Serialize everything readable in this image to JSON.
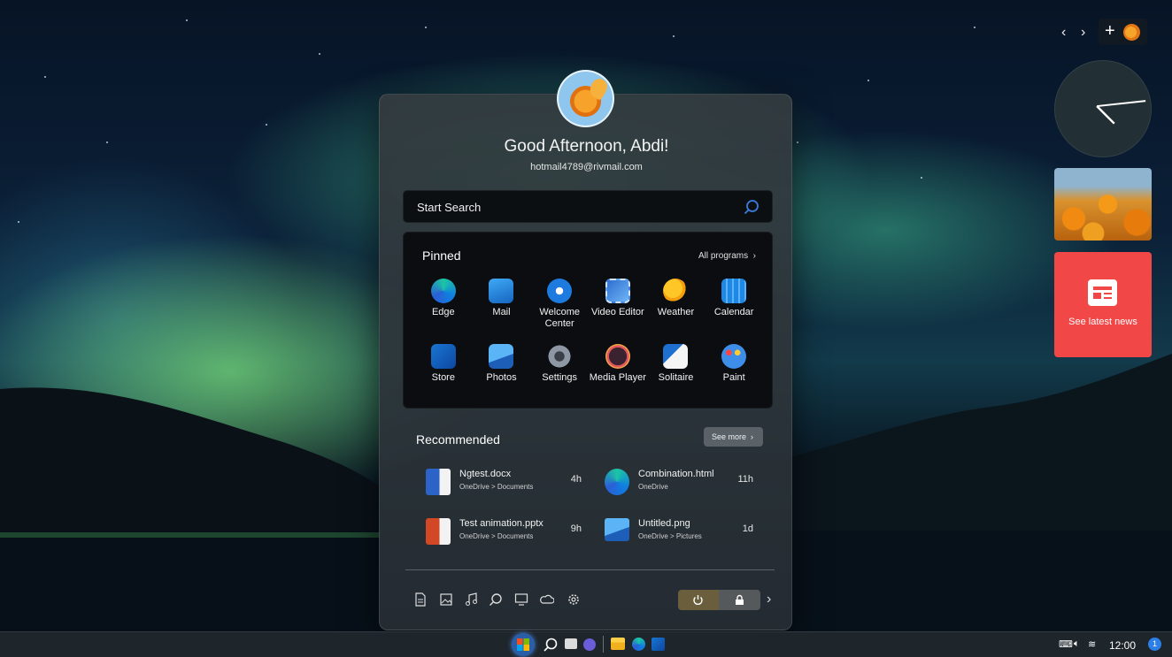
{
  "start_menu": {
    "greeting": "Good Afternoon, Abdi!",
    "email": "hotmail4789@rivmail.com",
    "search_placeholder": "Start Search",
    "pinned": {
      "title": "Pinned",
      "all_programs": "All programs",
      "apps": [
        {
          "label": "Edge",
          "icon": "edge-icon"
        },
        {
          "label": "Mail",
          "icon": "mail-icon"
        },
        {
          "label": "Welcome Center",
          "icon": "welcome-center-icon"
        },
        {
          "label": "Video Editor",
          "icon": "video-editor-icon"
        },
        {
          "label": "Weather",
          "icon": "weather-icon"
        },
        {
          "label": "Calendar",
          "icon": "calendar-icon"
        },
        {
          "label": "Store",
          "icon": "store-icon"
        },
        {
          "label": "Photos",
          "icon": "photos-icon"
        },
        {
          "label": "Settings",
          "icon": "settings-icon"
        },
        {
          "label": "Media Player",
          "icon": "media-player-icon"
        },
        {
          "label": "Solitaire",
          "icon": "solitaire-icon"
        },
        {
          "label": "Paint",
          "icon": "paint-icon"
        }
      ]
    },
    "recommended": {
      "title": "Recommended",
      "see_more": "See more",
      "items": [
        {
          "name": "Ngtest.docx",
          "path": "OneDrive > Documents",
          "time": "4h",
          "icon": "word-file-icon"
        },
        {
          "name": "Combination.html",
          "path": "OneDrive",
          "time": "11h",
          "icon": "edge-file-icon"
        },
        {
          "name": "Test animation.pptx",
          "path": "OneDrive > Documents",
          "time": "9h",
          "icon": "powerpoint-file-icon"
        },
        {
          "name": "Untitled.png",
          "path": "OneDrive > Pictures",
          "time": "1d",
          "icon": "image-file-icon"
        }
      ]
    },
    "quick_links": [
      "documents-icon",
      "pictures-icon",
      "music-icon",
      "search-icon",
      "desktop-icon",
      "onedrive-icon",
      "settings-icon"
    ]
  },
  "widgets": {
    "news_label": "See latest news"
  },
  "taskbar": {
    "time": "12:00",
    "notification_count": "1"
  },
  "colors": {
    "news_card": "#f24747",
    "accent_blue": "#2d7fe8",
    "power_button": "#6a5e3c"
  }
}
